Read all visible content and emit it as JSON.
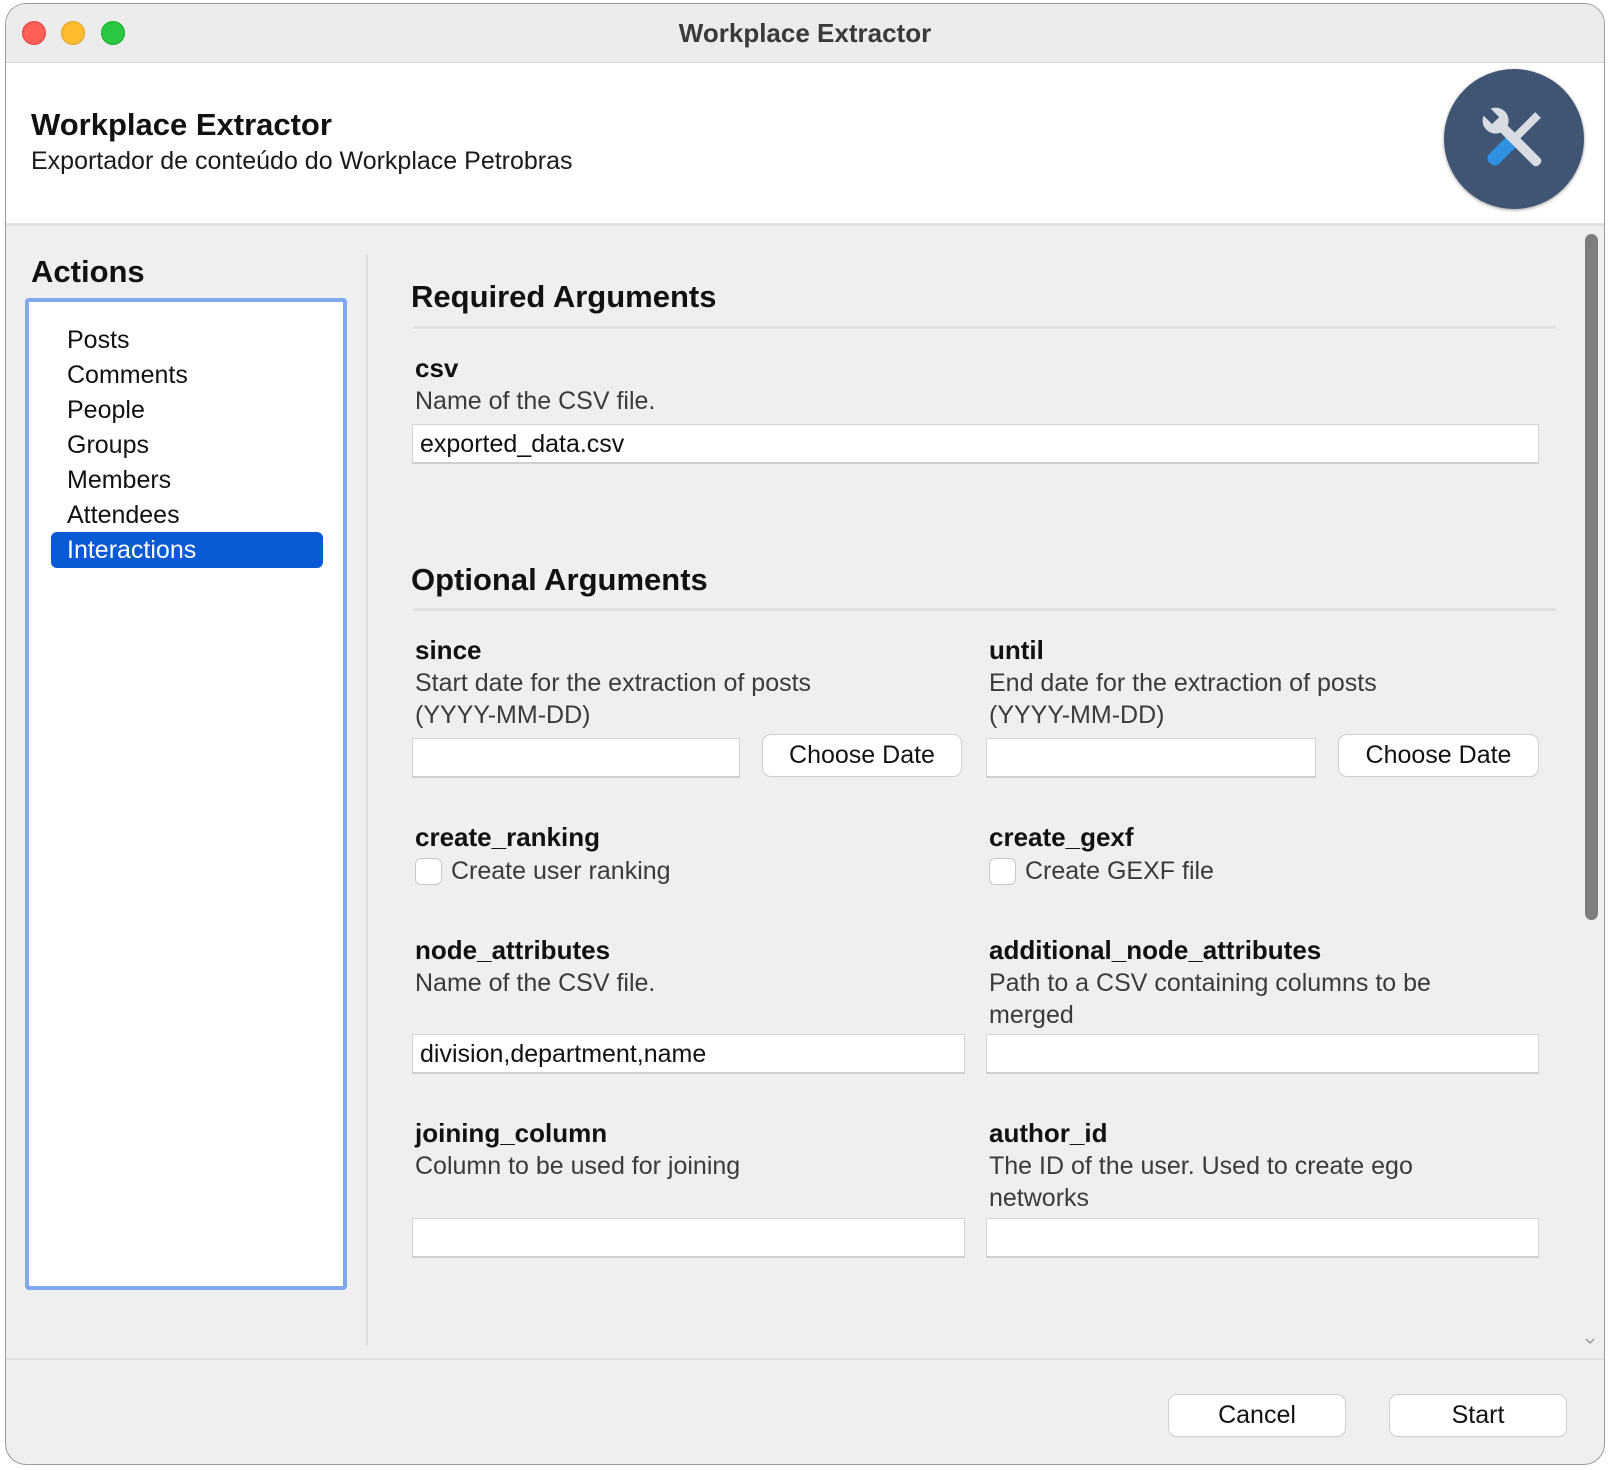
{
  "window": {
    "title": "Workplace Extractor"
  },
  "header": {
    "title": "Workplace Extractor",
    "subtitle": "Exportador de conteúdo do Workplace Petrobras",
    "icon": "tools-icon"
  },
  "sidebar": {
    "heading": "Actions",
    "items": [
      {
        "label": "Posts",
        "selected": false
      },
      {
        "label": "Comments",
        "selected": false
      },
      {
        "label": "People",
        "selected": false
      },
      {
        "label": "Groups",
        "selected": false
      },
      {
        "label": "Members",
        "selected": false
      },
      {
        "label": "Attendees",
        "selected": false
      },
      {
        "label": "Interactions",
        "selected": true
      }
    ],
    "accent_color": "#0a5ad6"
  },
  "required": {
    "heading": "Required Arguments",
    "csv": {
      "label": "csv",
      "description": "Name of the CSV file.",
      "value": "exported_data.csv"
    }
  },
  "optional": {
    "heading": "Optional Arguments",
    "since": {
      "label": "since",
      "description_line1": "Start date for the extraction of posts",
      "description_line2": "(YYYY-MM-DD)",
      "value": "",
      "button": "Choose Date"
    },
    "until": {
      "label": "until",
      "description_line1": "End date for the extraction of posts",
      "description_line2": "(YYYY-MM-DD)",
      "value": "",
      "button": "Choose Date"
    },
    "create_ranking": {
      "label": "create_ranking",
      "checkbox_label": "Create user ranking",
      "checked": false
    },
    "create_gexf": {
      "label": "create_gexf",
      "checkbox_label": "Create GEXF file",
      "checked": false
    },
    "node_attributes": {
      "label": "node_attributes",
      "description": "Name of the CSV file.",
      "value": "division,department,name"
    },
    "additional_node_attributes": {
      "label": "additional_node_attributes",
      "description_line1": "Path to a CSV containing columns to be",
      "description_line2": "merged",
      "value": ""
    },
    "joining_column": {
      "label": "joining_column",
      "description": "Column to be used for joining",
      "value": ""
    },
    "author_id": {
      "label": "author_id",
      "description_line1": "The ID of the user. Used to create ego",
      "description_line2": "networks",
      "value": ""
    }
  },
  "footer": {
    "cancel": "Cancel",
    "start": "Start"
  }
}
